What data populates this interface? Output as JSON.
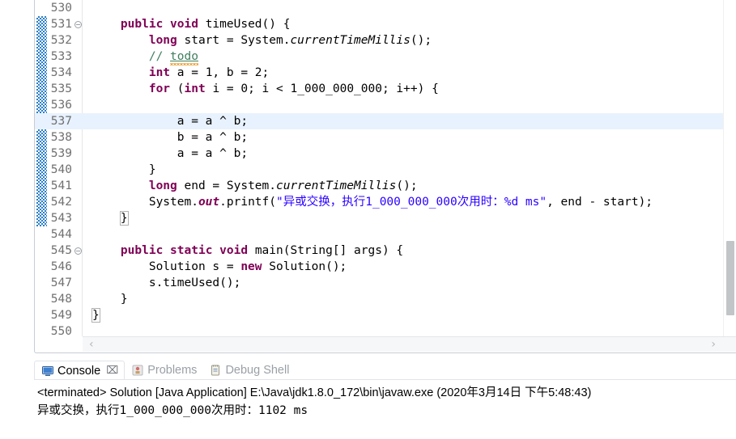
{
  "editor": {
    "first_line": 530,
    "current_line": 537,
    "change_bar_from": 531,
    "change_bar_to": 543,
    "lines": [
      {
        "no": "530",
        "fold": false,
        "tokens": []
      },
      {
        "no": "531",
        "fold": true,
        "tokens": [
          {
            "t": "    ",
            "c": "plain"
          },
          {
            "t": "public",
            "c": "kw"
          },
          {
            "t": " ",
            "c": "plain"
          },
          {
            "t": "void",
            "c": "kw"
          },
          {
            "t": " timeUsed() {",
            "c": "plain"
          }
        ]
      },
      {
        "no": "532",
        "fold": false,
        "tokens": [
          {
            "t": "        ",
            "c": "plain"
          },
          {
            "t": "long",
            "c": "kw"
          },
          {
            "t": " start = System.",
            "c": "plain"
          },
          {
            "t": "currentTimeMillis",
            "c": "stat"
          },
          {
            "t": "();",
            "c": "plain"
          }
        ]
      },
      {
        "no": "533",
        "fold": false,
        "tokens": [
          {
            "t": "        ",
            "c": "plain"
          },
          {
            "t": "// ",
            "c": "cmt"
          },
          {
            "t": "todo",
            "c": "cmt-task"
          }
        ]
      },
      {
        "no": "534",
        "fold": false,
        "tokens": [
          {
            "t": "        ",
            "c": "plain"
          },
          {
            "t": "int",
            "c": "kw"
          },
          {
            "t": " a = 1, b = 2;",
            "c": "plain"
          }
        ]
      },
      {
        "no": "535",
        "fold": false,
        "tokens": [
          {
            "t": "        ",
            "c": "plain"
          },
          {
            "t": "for",
            "c": "kw"
          },
          {
            "t": " (",
            "c": "plain"
          },
          {
            "t": "int",
            "c": "kw"
          },
          {
            "t": " i = 0; i < 1_000_000_000; i++) {",
            "c": "plain"
          }
        ]
      },
      {
        "no": "536",
        "fold": false,
        "tokens": []
      },
      {
        "no": "537",
        "fold": false,
        "tokens": [
          {
            "t": "            a = a ^ b;",
            "c": "plain"
          }
        ]
      },
      {
        "no": "538",
        "fold": false,
        "tokens": [
          {
            "t": "            b = a ^ b;",
            "c": "plain"
          }
        ]
      },
      {
        "no": "539",
        "fold": false,
        "tokens": [
          {
            "t": "            a = a ^ b;",
            "c": "plain"
          }
        ]
      },
      {
        "no": "540",
        "fold": false,
        "tokens": [
          {
            "t": "        }",
            "c": "plain"
          }
        ]
      },
      {
        "no": "541",
        "fold": false,
        "tokens": [
          {
            "t": "        ",
            "c": "plain"
          },
          {
            "t": "long",
            "c": "kw"
          },
          {
            "t": " end = System.",
            "c": "plain"
          },
          {
            "t": "currentTimeMillis",
            "c": "stat"
          },
          {
            "t": "();",
            "c": "plain"
          }
        ]
      },
      {
        "no": "542",
        "fold": false,
        "tokens": [
          {
            "t": "        System.",
            "c": "plain"
          },
          {
            "t": "out",
            "c": "statb"
          },
          {
            "t": ".printf(",
            "c": "plain"
          },
          {
            "t": "\"异或交换，执行1_000_000_000次用时：%d ms\"",
            "c": "str"
          },
          {
            "t": ", end - start);",
            "c": "plain"
          }
        ]
      },
      {
        "no": "543",
        "fold": false,
        "tokens": [
          {
            "t": "    ",
            "c": "plain"
          },
          {
            "t": "}",
            "c": "brk"
          }
        ]
      },
      {
        "no": "544",
        "fold": false,
        "tokens": []
      },
      {
        "no": "545",
        "fold": true,
        "tokens": [
          {
            "t": "    ",
            "c": "plain"
          },
          {
            "t": "public",
            "c": "kw"
          },
          {
            "t": " ",
            "c": "plain"
          },
          {
            "t": "static",
            "c": "kw"
          },
          {
            "t": " ",
            "c": "plain"
          },
          {
            "t": "void",
            "c": "kw"
          },
          {
            "t": " main(String[] args) {",
            "c": "plain"
          }
        ]
      },
      {
        "no": "546",
        "fold": false,
        "tokens": [
          {
            "t": "        Solution s = ",
            "c": "plain"
          },
          {
            "t": "new",
            "c": "kw"
          },
          {
            "t": " Solution();",
            "c": "plain"
          }
        ]
      },
      {
        "no": "547",
        "fold": false,
        "tokens": [
          {
            "t": "        s.timeUsed();",
            "c": "plain"
          }
        ]
      },
      {
        "no": "548",
        "fold": false,
        "tokens": [
          {
            "t": "    }",
            "c": "plain"
          }
        ]
      },
      {
        "no": "549",
        "fold": false,
        "tokens": [
          {
            "t": "}",
            "c": "brk"
          }
        ]
      },
      {
        "no": "550",
        "fold": false,
        "tokens": []
      }
    ],
    "h_scroll_left_arrow": "‹",
    "h_scroll_right_arrow": "›"
  },
  "console": {
    "tabs": [
      {
        "label": "Console",
        "active": true,
        "icon": "console-icon",
        "closable": true,
        "close": "⌧"
      },
      {
        "label": "Problems",
        "active": false,
        "icon": "problems-icon",
        "closable": false,
        "close": ""
      },
      {
        "label": "Debug Shell",
        "active": false,
        "icon": "debug-shell-icon",
        "closable": false,
        "close": ""
      }
    ],
    "header_line": "<terminated> Solution [Java Application] E:\\Java\\jdk1.8.0_172\\bin\\javaw.exe (2020年3月14日 下午5:48:43)",
    "output_line": "异或交换，执行1_000_000_000次用时：1102 ms"
  },
  "colors": {
    "keyword": "#7f0055",
    "comment": "#3f7f5f",
    "string": "#2a00ff",
    "current_line": "#e8f2fe",
    "change_bar": "#2a7fc9",
    "line_number": "#707070"
  }
}
